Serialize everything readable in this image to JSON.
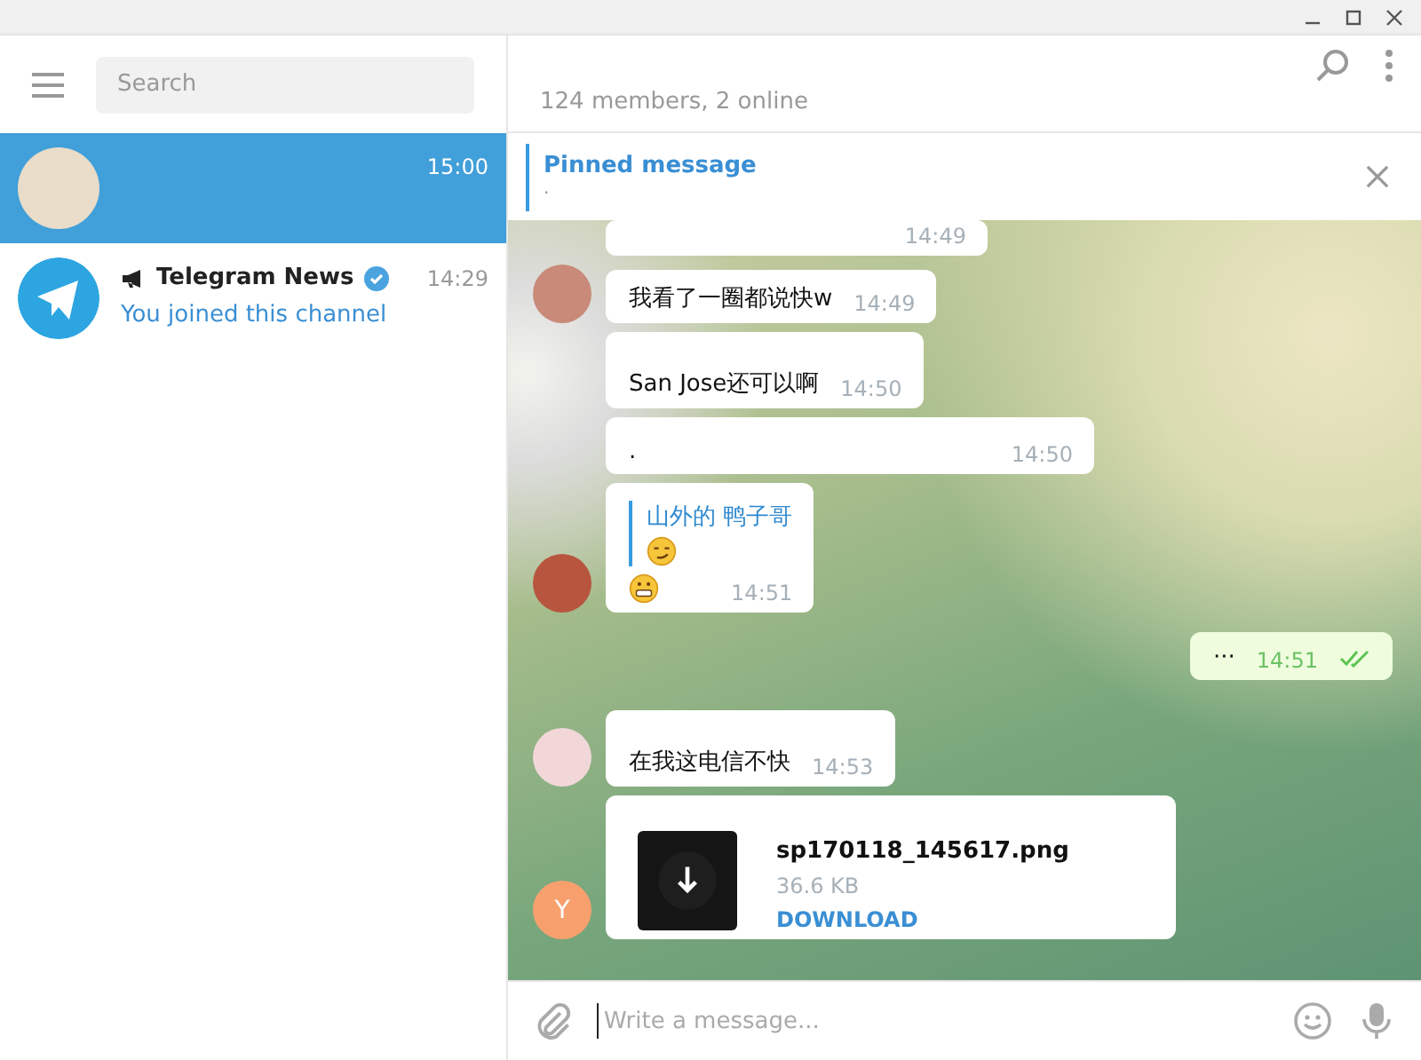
{
  "sidebar": {
    "search": {
      "placeholder": "Search"
    },
    "chats": [
      {
        "avatar": {
          "kind": "image",
          "color": "#e9dcc8"
        },
        "time": "15:00",
        "selected": true
      },
      {
        "avatar": {
          "kind": "telegram",
          "color": "#2ca5e0"
        },
        "name": "Telegram News",
        "channel": true,
        "verified": true,
        "preview": "You joined this channel",
        "time": "14:29",
        "selected": false
      }
    ]
  },
  "header": {
    "status": "124 members, 2 online"
  },
  "pinned": {
    "label": "Pinned message",
    "text": "."
  },
  "messages": [
    {
      "kind": "text",
      "time": "14:49",
      "outgoing": false
    },
    {
      "kind": "text",
      "text": "我看了一圈都说快w",
      "time": "14:49",
      "outgoing": false,
      "avatar": {
        "kind": "image",
        "color": "#c98a7a"
      }
    },
    {
      "kind": "text",
      "text": "San Jose还可以啊",
      "time": "14:50",
      "outgoing": false,
      "tall": true
    },
    {
      "kind": "text",
      "text": ".",
      "time": "14:50",
      "outgoing": false
    },
    {
      "kind": "reply",
      "author": "山外的 鸭子哥",
      "time": "14:51",
      "outgoing": false,
      "avatar": {
        "kind": "image",
        "color": "#b8553f"
      }
    },
    {
      "kind": "text",
      "text": "···",
      "time": "14:51",
      "outgoing": true,
      "read": true
    },
    {
      "kind": "text",
      "text": "在我这电信不快",
      "time": "14:53",
      "outgoing": false,
      "avatar": {
        "kind": "image",
        "color": "#f2d7d9"
      },
      "tall": true
    },
    {
      "kind": "file",
      "name": "sp170118_145617.png",
      "size": "36.6 KB",
      "action": "DOWNLOAD",
      "outgoing": false,
      "avatar": {
        "kind": "letter",
        "letter": "Y",
        "color": "#f7a06e"
      }
    }
  ],
  "composer": {
    "placeholder": "Write a message..."
  }
}
